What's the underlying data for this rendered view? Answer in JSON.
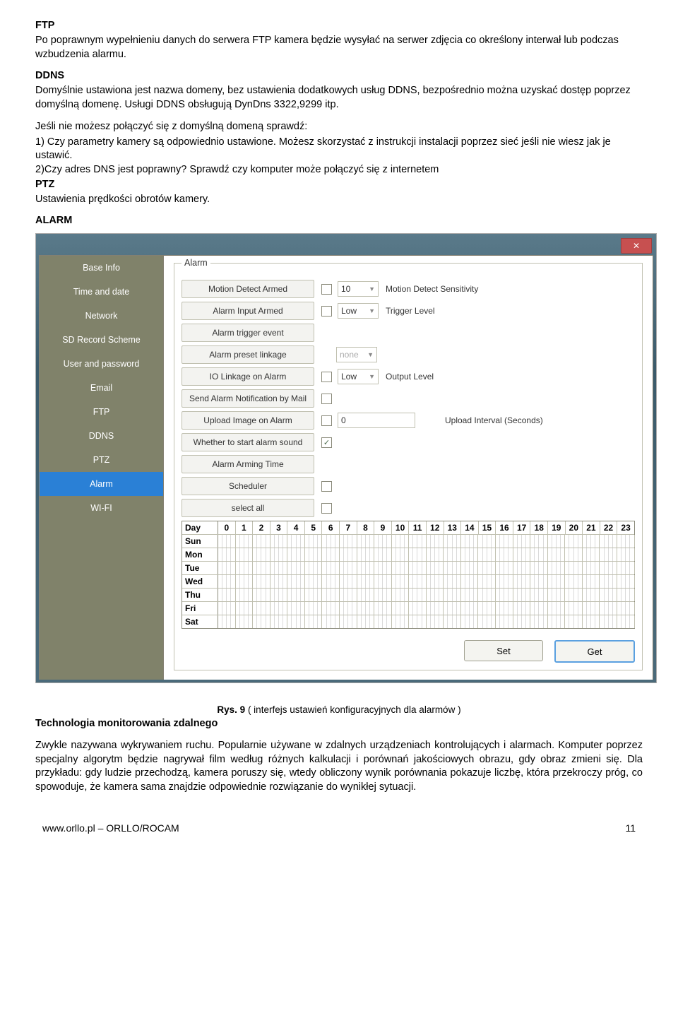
{
  "doc": {
    "ftp_heading": "FTP",
    "ftp_para": "Po poprawnym wypełnieniu danych do serwera FTP kamera będzie wysyłać na serwer zdjęcia co określony interwał lub podczas wzbudzenia alarmu.",
    "ddns_heading": "DDNS",
    "ddns_para1": "Domyślnie ustawiona jest nazwa domeny, bez ustawienia dodatkowych usług DDNS, bezpośrednio można uzyskać dostęp poprzez domyślną domenę. Usługi DDNS obsługują DynDns 3322,9299 itp.",
    "ddns_para2": "Jeśli nie możesz połączyć się z domyślną domeną sprawdź:",
    "ddns_li1": "1) Czy parametry kamery są odpowiednio ustawione. Możesz skorzystać z instrukcji instalacji poprzez sieć jeśli nie wiesz jak je ustawić.",
    "ddns_li2": "2)Czy adres DNS jest poprawny? Sprawdź czy komputer może połączyć się z internetem",
    "ptz_heading": "PTZ",
    "ptz_para": "Ustawienia prędkości obrotów kamery.",
    "alarm_heading": "ALARM",
    "figure_label": "Rys. 9",
    "figure_caption": " ( interfejs ustawień konfiguracyjnych  dla alarmów )",
    "tech_heading": "Technologia monitorowania zdalnego",
    "tech_para": "Zwykle nazywana wykrywaniem ruchu. Popularnie używane w zdalnych urządzeniach kontrolujących i alarmach. Komputer poprzez specjalny algorytm będzie nagrywał film według różnych kalkulacji i porównań jakościowych obrazu, gdy obraz zmieni się. Dla przykładu: gdy ludzie przechodzą, kamera poruszy się, wtedy obliczony wynik porównania pokazuje liczbę, która przekroczy próg, co spowoduje, że kamera sama znajdzie odpowiednie rozwiązanie do wynikłej sytuacji.",
    "footer_left": "www.orllo.pl   –  ORLLO/ROCAM",
    "footer_right": "11"
  },
  "ui": {
    "close_x": "✕",
    "sidebar": {
      "items": [
        "Base Info",
        "Time and date",
        "Network",
        "SD Record Scheme",
        "User and password",
        "Email",
        "FTP",
        "DDNS",
        "PTZ",
        "Alarm",
        "WI-FI"
      ],
      "active_index": 9
    },
    "panel": {
      "legend": "Alarm",
      "rows": {
        "motion_detect_armed": "Motion Detect Armed",
        "motion_detect_sensitivity_label": "Motion Detect Sensitivity",
        "motion_detect_sensitivity_value": "10",
        "alarm_input_armed": "Alarm Input Armed",
        "trigger_level_label": "Trigger Level",
        "trigger_level_value": "Low",
        "alarm_trigger_event": "Alarm trigger event",
        "alarm_preset_linkage": "Alarm preset linkage",
        "alarm_preset_linkage_value": "none",
        "io_linkage_on_alarm": "IO Linkage on Alarm",
        "output_level_label": "Output Level",
        "output_level_value": "Low",
        "send_alarm_mail": "Send Alarm Notification by Mail",
        "upload_image_on_alarm": "Upload Image on Alarm",
        "upload_interval_label": "Upload Interval (Seconds)",
        "upload_interval_value": "0",
        "start_alarm_sound": "Whether to start alarm sound",
        "alarm_arming_time": "Alarm Arming Time",
        "scheduler": "Scheduler",
        "select_all": "select all"
      },
      "check_on": "✓",
      "chevron": "▼",
      "schedule": {
        "day_label": "Day",
        "hours": [
          "0",
          "1",
          "2",
          "3",
          "4",
          "5",
          "6",
          "7",
          "8",
          "9",
          "10",
          "11",
          "12",
          "13",
          "14",
          "15",
          "16",
          "17",
          "18",
          "19",
          "20",
          "21",
          "22",
          "23"
        ],
        "days": [
          "Sun",
          "Mon",
          "Tue",
          "Wed",
          "Thu",
          "Fri",
          "Sat"
        ]
      },
      "set_btn": "Set",
      "get_btn": "Get"
    }
  }
}
